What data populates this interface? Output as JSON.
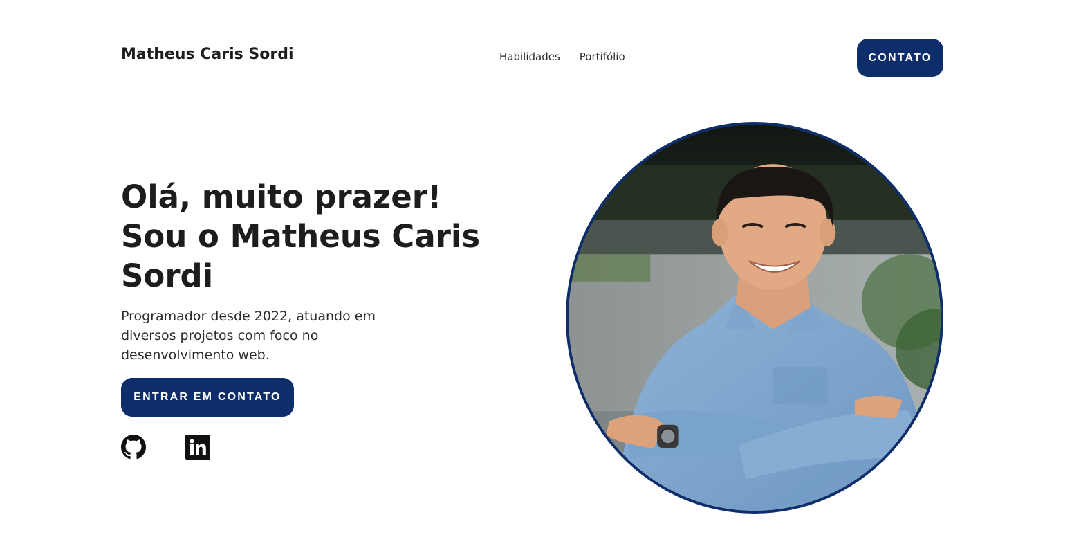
{
  "header": {
    "brand": "Matheus Caris Sordi",
    "nav": [
      {
        "label": "Habilidades"
      },
      {
        "label": "Portifólio"
      }
    ],
    "contact_button": "CONTATO"
  },
  "hero": {
    "title_lines": [
      "Olá, muito prazer!",
      "Sou o Matheus Caris",
      "Sordi"
    ],
    "description": "Programador desde 2022, atuando em diversos projetos com foco no desenvolvimento web.",
    "cta_button": "ENTRAR EM CONTATO"
  },
  "socials": [
    {
      "icon": "github-icon"
    },
    {
      "icon": "linkedin-icon"
    }
  ],
  "colors": {
    "accent": "#0e2d6b",
    "text": "#1d1d1d",
    "background": "#ffffff"
  }
}
